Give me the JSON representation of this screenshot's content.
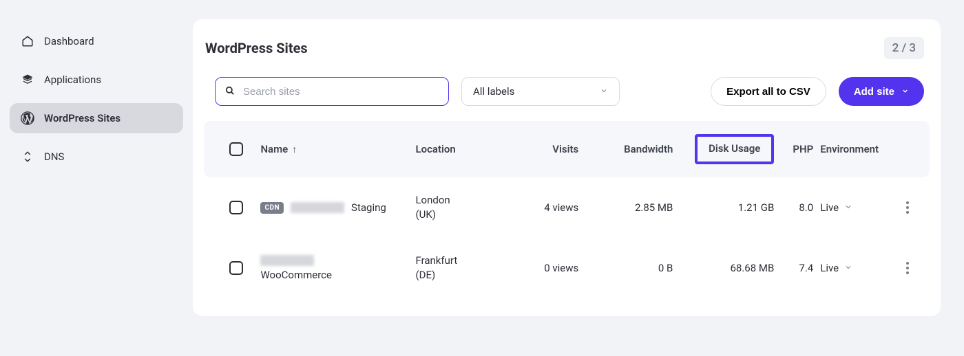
{
  "sidebar": {
    "items": [
      {
        "label": "Dashboard"
      },
      {
        "label": "Applications"
      },
      {
        "label": "WordPress Sites"
      },
      {
        "label": "DNS"
      }
    ]
  },
  "header": {
    "title": "WordPress Sites",
    "count": "2 / 3"
  },
  "controls": {
    "search_placeholder": "Search sites",
    "labels_select": "All labels",
    "export_label": "Export all to CSV",
    "add_label": "Add site"
  },
  "table": {
    "columns": {
      "name": "Name",
      "location": "Location",
      "visits": "Visits",
      "bandwidth": "Bandwidth",
      "disk": "Disk Usage",
      "php": "PHP",
      "environment": "Environment"
    },
    "rows": [
      {
        "cdn": "CDN",
        "name_suffix": "Staging",
        "location_line1": "London",
        "location_line2": "(UK)",
        "visits": "4 views",
        "bandwidth": "2.85 MB",
        "disk": "1.21 GB",
        "php": "8.0",
        "env": "Live"
      },
      {
        "cdn": "",
        "name_suffix": "WooCommerce",
        "location_line1": "Frankfurt",
        "location_line2": "(DE)",
        "visits": "0 views",
        "bandwidth": "0 B",
        "disk": "68.68 MB",
        "php": "7.4",
        "env": "Live"
      }
    ]
  }
}
